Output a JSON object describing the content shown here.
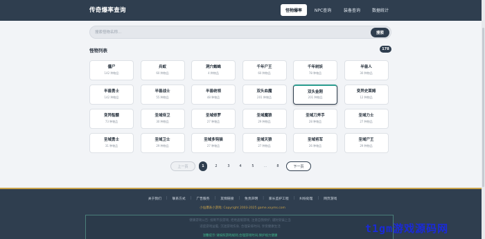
{
  "header": {
    "title": "传奇爆率查询",
    "nav": [
      "怪物爆率",
      "NPC查询",
      "装备查询",
      "数据统计"
    ],
    "active_index": 0
  },
  "search": {
    "placeholder": "搜索怪物名称...",
    "button_label": "搜索"
  },
  "list": {
    "title": "怪物列表",
    "total": "178",
    "cards": [
      {
        "name": "僵尸",
        "sub": "142 种物品"
      },
      {
        "name": "兵蚁",
        "sub": "60 种物品"
      },
      {
        "name": "洞穴蜘蛛",
        "sub": "4 种物品"
      },
      {
        "name": "千年尸王",
        "sub": "60 种物品"
      },
      {
        "name": "千年树妖",
        "sub": "78 种物品"
      },
      {
        "name": "半兽人",
        "sub": "30 种物品"
      },
      {
        "name": "半兽勇士",
        "sub": "142 种物品"
      },
      {
        "name": "半兽战士",
        "sub": "55 种物品"
      },
      {
        "name": "半兽统领",
        "sub": "48 种物品"
      },
      {
        "name": "双头血魔",
        "sub": "201 种物品"
      },
      {
        "name": "双头金刚",
        "sub": "201 种物品"
      },
      {
        "name": "变异史莱姆",
        "sub": "12 种物品"
      },
      {
        "name": "变异骷髅",
        "sub": "73 种物品"
      },
      {
        "name": "圣域侍卫",
        "sub": "30 种物品"
      },
      {
        "name": "圣域修罗",
        "sub": "27 种物品"
      },
      {
        "name": "圣域魔狼",
        "sub": "29 种物品"
      },
      {
        "name": "圣域刀斧手",
        "sub": "28 种物品"
      },
      {
        "name": "圣域力士",
        "sub": "27 种物品"
      },
      {
        "name": "圣域勇士",
        "sub": "31 种物品"
      },
      {
        "name": "圣域卫士",
        "sub": "29 种物品"
      },
      {
        "name": "圣域多钩猫",
        "sub": "27 种物品"
      },
      {
        "name": "圣域天狼",
        "sub": "27 种物品"
      },
      {
        "name": "圣域将军",
        "sub": "26 种物品"
      },
      {
        "name": "圣域尸王",
        "sub": "29 种物品"
      }
    ],
    "hover_index": 10
  },
  "pagination": {
    "prev": "上一页",
    "pages": [
      "1",
      "2",
      "3",
      "4",
      "5"
    ],
    "ellipsis": "...",
    "last": "8",
    "next": "下一页",
    "current": "1"
  },
  "footer": {
    "links": [
      "关于我们",
      "联系方式",
      "广告服务",
      "友情链接",
      "免责声明",
      "家长监护工程",
      "纠纷处理",
      "网页游戏"
    ],
    "copyright": "小仙爆表小游戏: Copyright 2003-2025 game.xxyms.com",
    "notice_lines": [
      "健康游戏公告: 抵制不良游戏, 拒绝盗版游戏, 注意自我保护, 谨防受骗上当",
      "适度游戏益脑, 沉迷游戏伤身, 合理安排时间, 享受健康生活",
      "温馨提示:请按照游戏规则,合理游戏时间,保护视力健康"
    ]
  },
  "watermark": "t1gm游戏源码网"
}
